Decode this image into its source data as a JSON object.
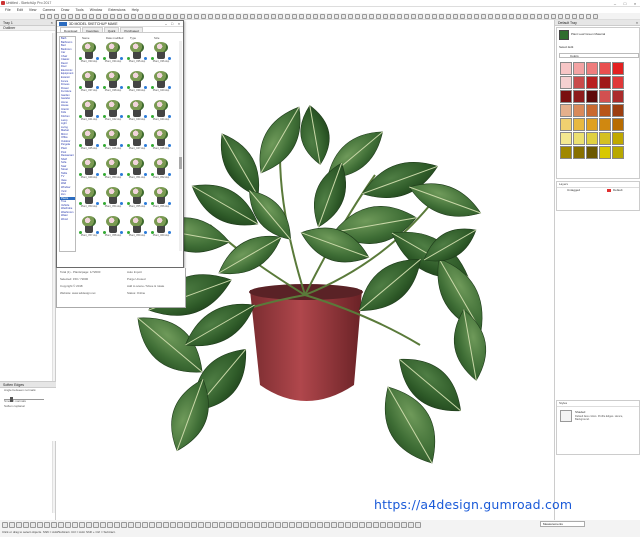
{
  "app": {
    "title": "Untitled - SketchUp Pro 2017"
  },
  "menu": [
    "File",
    "Edit",
    "View",
    "Camera",
    "Draw",
    "Tools",
    "Window",
    "Extensions",
    "Help"
  ],
  "left_tray": {
    "title": "Tray 1",
    "section": "Outliner"
  },
  "shapes_panel": {
    "title": "Soften Edges",
    "angle_label": "Angle between normals:",
    "smooth_label": "Smooth normals",
    "coplanar_label": "Soften coplanar"
  },
  "model_window": {
    "title": "3D MODEL SKETCHUP MAKE",
    "tabs": [
      "Download",
      "Favorites",
      "Quick",
      "Purchased"
    ],
    "columns": [
      "Name",
      "Date modified",
      "Type",
      "Size"
    ],
    "categories": [
      "Bath",
      "Bathroom",
      "Bed",
      "Bedroom",
      "Car",
      "Chair",
      "Classic",
      "Decor",
      "Door",
      "Electronic",
      "Equipment",
      "Exterior",
      "Fence",
      "Fitness",
      "Flower",
      "Furniture",
      "Garden",
      "Gazebo",
      "Home",
      "House",
      "Interior",
      "Kids",
      "Kitchen",
      "Lamp",
      "Light",
      "Living",
      "Market",
      "Mirror",
      "Office",
      "Outdoor",
      "Pergola",
      "Plant",
      "Pool",
      "Restaurant",
      "Shelf",
      "Sofa",
      "Stair",
      "Street",
      "Table",
      "TV",
      "Vase",
      "Wall",
      "Window",
      "Yard",
      "Zen",
      "Plants",
      "Tree",
      "Vehicle",
      "Wardrobe",
      "Washroom",
      "Water",
      "Wood"
    ],
    "selected_category": "Plants",
    "items": [
      {
        "cap": "Plant_033.skp"
      },
      {
        "cap": "Plant_034.skp"
      },
      {
        "cap": "Plant_035.skp"
      },
      {
        "cap": "Plant_036.skp"
      },
      {
        "cap": "Plant_037.skp"
      },
      {
        "cap": "Plant_038.skp"
      },
      {
        "cap": "Plant_039.skp"
      },
      {
        "cap": "Plant_040.skp"
      },
      {
        "cap": "Plant_041.skp"
      },
      {
        "cap": "Plant_042.skp"
      },
      {
        "cap": "Plant_043.skp"
      },
      {
        "cap": "Plant_044.skp"
      },
      {
        "cap": "Plant_045.skp"
      },
      {
        "cap": "Plant_046.skp"
      },
      {
        "cap": "Plant_047.skp"
      },
      {
        "cap": "Plant_048.skp"
      },
      {
        "cap": "Plant_049.skp"
      },
      {
        "cap": "Plant_050.skp"
      },
      {
        "cap": "Plant_051.skp"
      },
      {
        "cap": "Plant_052.skp"
      },
      {
        "cap": "Plant_053.skp"
      },
      {
        "cap": "Plant_054.skp"
      },
      {
        "cap": "Plant_055.skp"
      },
      {
        "cap": "Plant_056.skp"
      },
      {
        "cap": "Plant_057.skp"
      },
      {
        "cap": "Plant_058.skp"
      },
      {
        "cap": "Plant_059.skp"
      },
      {
        "cap": "Plant_060.skp"
      }
    ],
    "links": "Website · Facebook · YouTube · Pinterest · Instagram · Gumroad",
    "footer": {
      "l1": "Total (1) - Plants/page: 1/72000",
      "l2": "Selected: 150 / 72000",
      "l3": "Copyright © 2018",
      "l4": "Website: www.a4design.net",
      "r1": "Auto Import",
      "r2": "Purge Unused",
      "r3": "Add to scene / Move & rotate",
      "r4": "Status: Online"
    }
  },
  "right_tray": {
    "title": "Default Tray",
    "materials": {
      "name": "Plant Leaf Green Material",
      "tabs": "Select   Edit",
      "dropdown": "Colors"
    },
    "palette": [
      "#f7c6c6",
      "#f3a3a3",
      "#ee7d7d",
      "#e94f4f",
      "#e32020",
      "#f5d0d0",
      "#c94b4b",
      "#b82020",
      "#a01a1a",
      "#e03838",
      "#7a1010",
      "#8e1c1c",
      "#5e0a0a",
      "#d25050",
      "#ab2b2b",
      "#e4b08c",
      "#d98a5a",
      "#c96a30",
      "#b85418",
      "#9c3e10",
      "#f0d070",
      "#e8b840",
      "#e0a020",
      "#d08810",
      "#b86c00",
      "#f4e890",
      "#ece070",
      "#e0d040",
      "#d4c020",
      "#c0a800",
      "#a08800",
      "#887000",
      "#6c5800",
      "#d8c800",
      "#b8a800"
    ],
    "layers": {
      "header": "Layers",
      "row": "Untagged",
      "vis": "Default"
    },
    "styles": {
      "header": "Styles",
      "name": "Shaded",
      "desc": "Default face colors. Profile Edges. Hence, Background."
    }
  },
  "status": {
    "hint": "Click or drag to select objects. Shift = Add/Subtract. Ctrl = Add. Shift + Ctrl = Subtract.",
    "measure_label": "Measurements"
  },
  "watermark": {
    "url": "https://a4design.gumroad.com"
  }
}
